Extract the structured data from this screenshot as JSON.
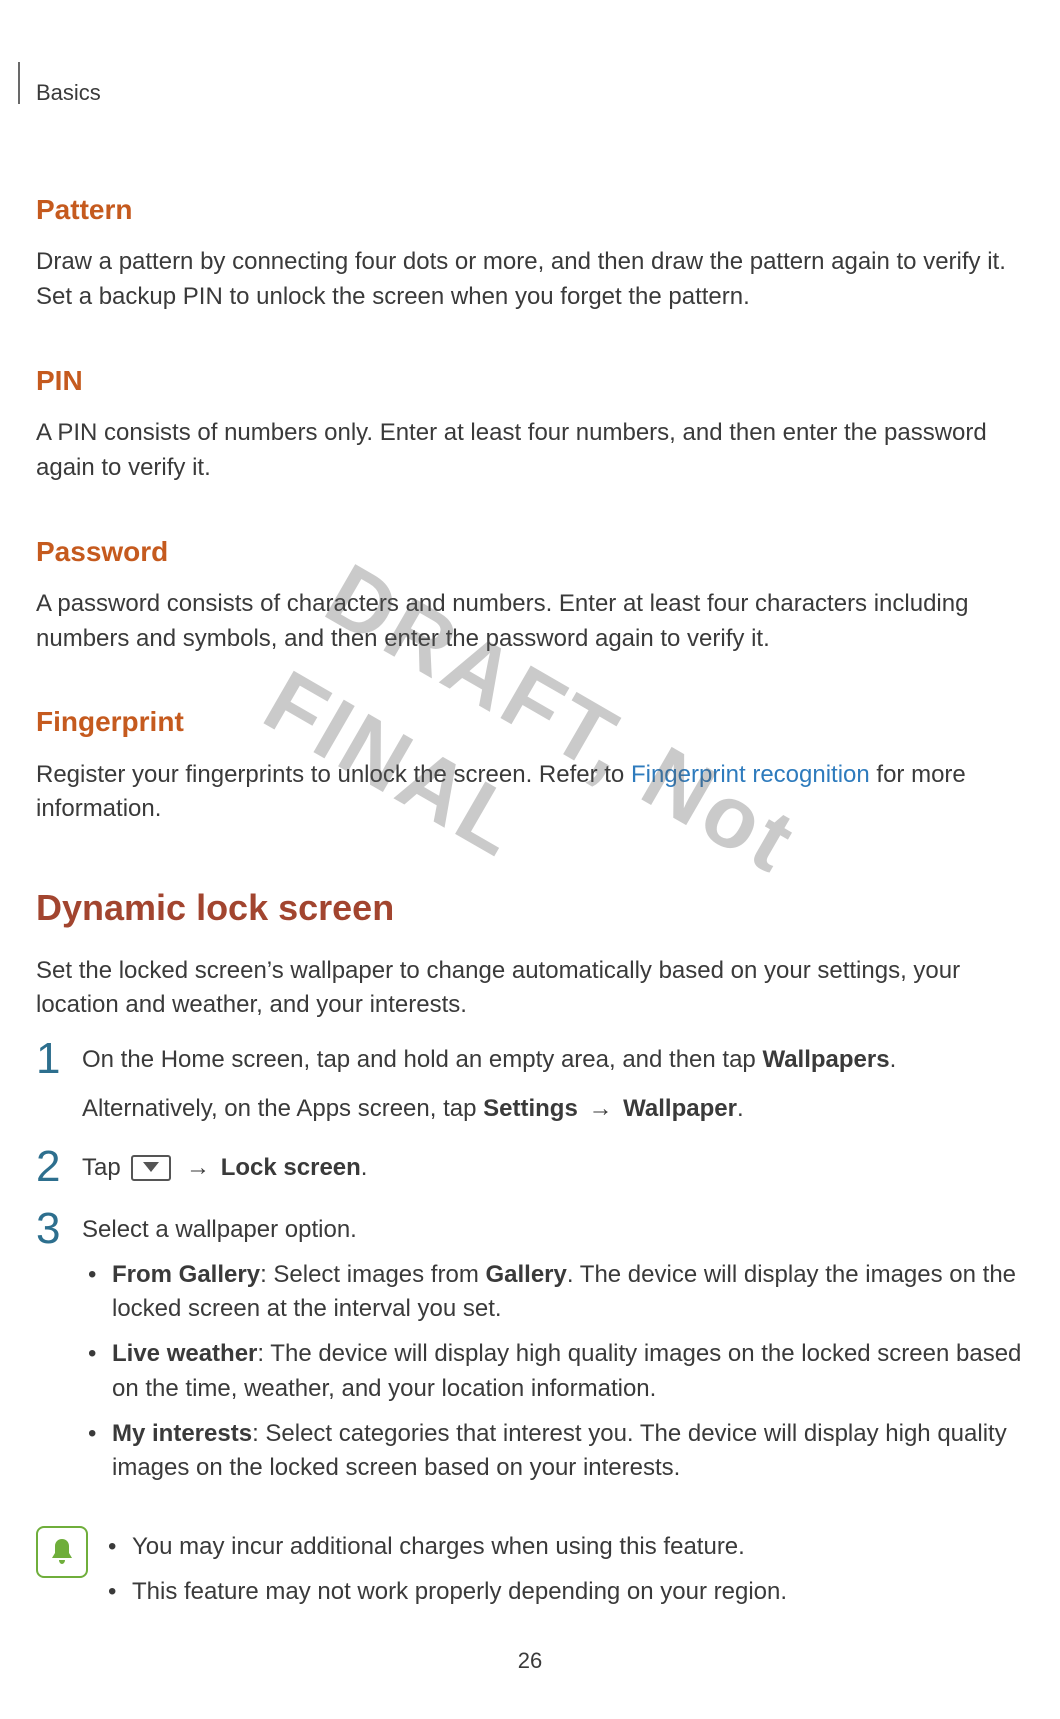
{
  "header": {
    "running": "Basics",
    "page_number": "26"
  },
  "watermark": "DRAFT, Not FINAL",
  "sections": {
    "pattern": {
      "title": "Pattern",
      "body": "Draw a pattern by connecting four dots or more, and then draw the pattern again to verify it. Set a backup PIN to unlock the screen when you forget the pattern."
    },
    "pin": {
      "title": "PIN",
      "body": "A PIN consists of numbers only. Enter at least four numbers, and then enter the password again to verify it."
    },
    "password": {
      "title": "Password",
      "body": "A password consists of characters and numbers. Enter at least four characters including numbers and symbols, and then enter the password again to verify it."
    },
    "fingerprint": {
      "title": "Fingerprint",
      "body_pre": "Register your fingerprints to unlock the screen. Refer to ",
      "link_text": "Fingerprint recognition",
      "body_post": " for more information."
    },
    "dynamic": {
      "title": "Dynamic lock screen",
      "intro": "Set the locked screen’s wallpaper to change automatically based on your settings, your location and weather, and your interests.",
      "step1_num": "1",
      "step1_line1_pre": "On the Home screen, tap and hold an empty area, and then tap ",
      "step1_line1_bold": "Wallpapers",
      "step1_line1_post": ".",
      "step1_line2_pre": "Alternatively, on the Apps screen, tap ",
      "step1_line2_bold1": "Settings",
      "step1_line2_arrow": " → ",
      "step1_line2_bold2": "Wallpaper",
      "step1_line2_post": ".",
      "step2_num": "2",
      "step2_pre": "Tap ",
      "step2_arrow": " → ",
      "step2_bold": "Lock screen",
      "step2_post": ".",
      "step3_num": "3",
      "step3_text": "Select a wallpaper option.",
      "bullets": [
        {
          "bold": "From Gallery",
          "text": ": Select images from ",
          "bold2": "Gallery",
          "text2": ". The device will display the images on the locked screen at the interval you set."
        },
        {
          "bold": "Live weather",
          "text": ": The device will display high quality images on the locked screen based on the time, weather, and your location information."
        },
        {
          "bold": "My interests",
          "text": ": Select categories that interest you. The device will display high quality images on the locked screen based on your interests."
        }
      ],
      "notes": [
        "You may incur additional charges when using this feature.",
        "This feature may not work properly depending on your region."
      ]
    }
  }
}
